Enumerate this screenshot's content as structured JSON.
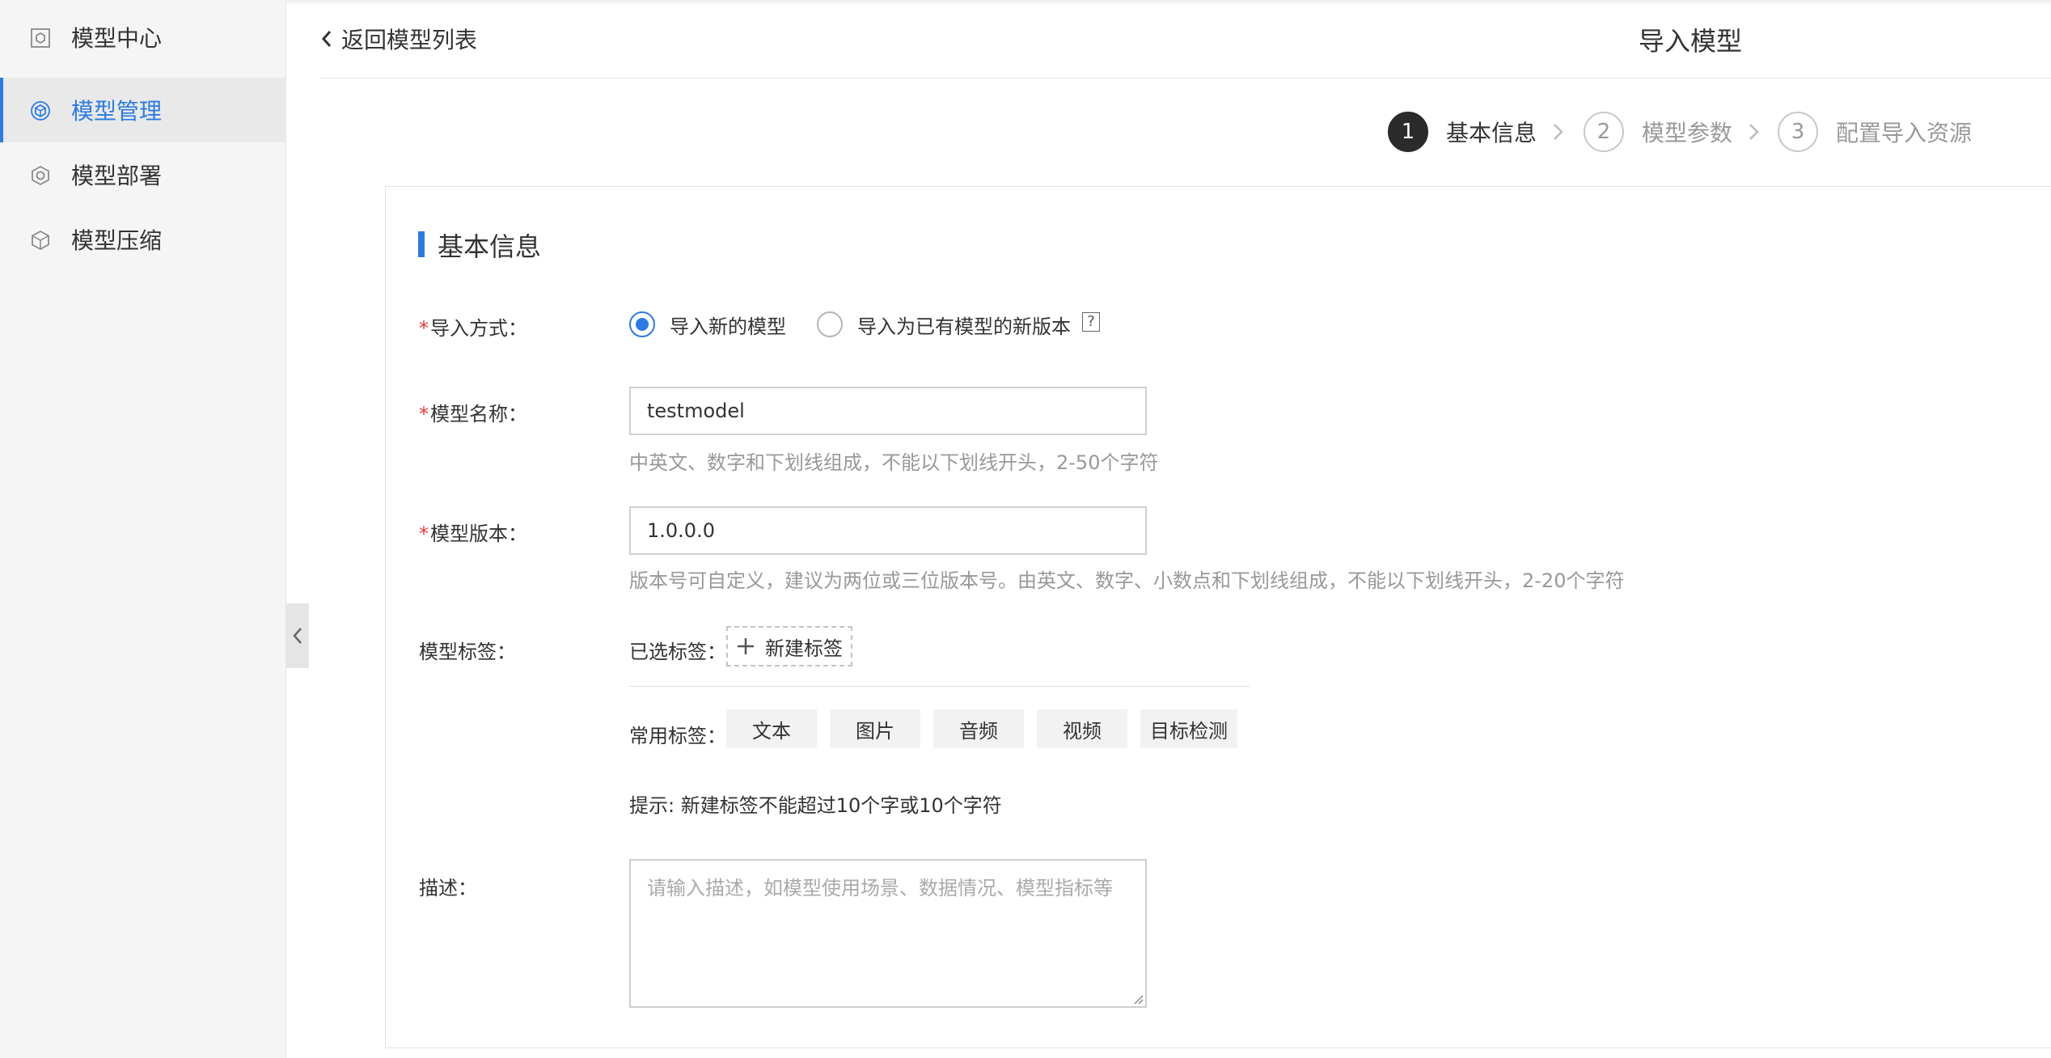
{
  "sidebar": {
    "items": [
      {
        "label": "模型中心",
        "icon": "model-center-icon",
        "active": false
      },
      {
        "label": "模型管理",
        "icon": "model-manage-icon",
        "active": true
      },
      {
        "label": "模型部署",
        "icon": "model-deploy-icon",
        "active": false
      },
      {
        "label": "模型压缩",
        "icon": "model-compress-icon",
        "active": false
      }
    ]
  },
  "header": {
    "back_label": "返回模型列表",
    "title": "导入模型"
  },
  "steps": [
    {
      "num": "1",
      "label": "基本信息",
      "active": true
    },
    {
      "num": "2",
      "label": "模型参数",
      "active": false
    },
    {
      "num": "3",
      "label": "配置导入资源",
      "active": false
    }
  ],
  "form": {
    "section_title": "基本信息",
    "required_mark": "*",
    "import_method": {
      "label": "导入方式：",
      "options": [
        "导入新的模型",
        "导入为已有模型的新版本"
      ],
      "selected": "导入新的模型",
      "help_icon": "?"
    },
    "model_name": {
      "label": "模型名称：",
      "value": "testmodel",
      "hint": "中英文、数字和下划线组成，不能以下划线开头，2-50个字符"
    },
    "model_version": {
      "label": "模型版本：",
      "value": "1.0.0.0",
      "hint": "版本号可自定义，建议为两位或三位版本号。由英文、数字、小数点和下划线组成，不能以下划线开头，2-20个字符"
    },
    "model_tags": {
      "label": "模型标签：",
      "selected_label": "已选标签：",
      "new_tag_label": "新建标签",
      "common_label": "常用标签：",
      "common_tags": [
        "文本",
        "图片",
        "音频",
        "视频",
        "目标检测"
      ],
      "tip": "提示: 新建标签不能超过10个字或10个字符"
    },
    "description": {
      "label": "描述：",
      "placeholder": "请输入描述，如模型使用场景、数据情况、模型指标等",
      "value": ""
    }
  },
  "colors": {
    "accent": "#2c7be5",
    "required": "#e5393a",
    "sidebar_bg": "#f5f5f5",
    "active_item_bg": "#e9e9e9"
  }
}
